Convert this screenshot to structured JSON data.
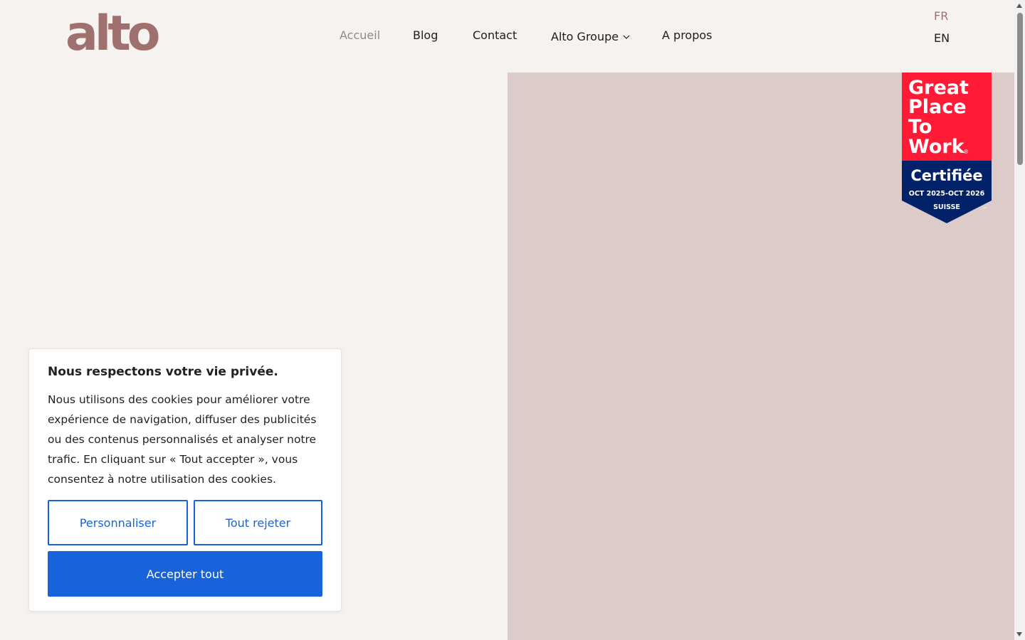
{
  "brand": {
    "logo_text": "alto",
    "logo_color": "#a0706f"
  },
  "nav": {
    "items": [
      {
        "label": "Accueil",
        "active": true
      },
      {
        "label": "Blog"
      },
      {
        "label": "Contact"
      },
      {
        "label": "Alto Groupe",
        "has_dropdown": true,
        "icon": "chevron-down-icon"
      },
      {
        "label": "A propos"
      }
    ]
  },
  "language": {
    "fr": "FR",
    "en": "EN",
    "current": "FR"
  },
  "badge": {
    "line1": "Great",
    "line2": "Place",
    "line3": "To",
    "line4": "Work",
    "registered": "®",
    "certified": "Certifiée",
    "period": "OCT 2025-OCT 2026",
    "country": "SUISSE",
    "trademark": "™",
    "colors": {
      "top": "#ff1a35",
      "bottom": "#012169"
    }
  },
  "cookie_banner": {
    "title": "Nous respectons votre vie privée.",
    "body": "Nous utilisons des cookies pour améliorer votre expérience de navigation, diffuser des publicités ou des contenus personnalisés et analyser notre trafic. En cliquant sur « Tout accepter », vous consentez à notre utilisation des cookies.",
    "customize_label": "Personnaliser",
    "reject_label": "Tout rejeter",
    "accept_label": "Accepter tout",
    "accent_color": "#1863dc"
  },
  "colors": {
    "page_bg": "#f6f2ef",
    "hero_panel": "#dccbc8"
  }
}
